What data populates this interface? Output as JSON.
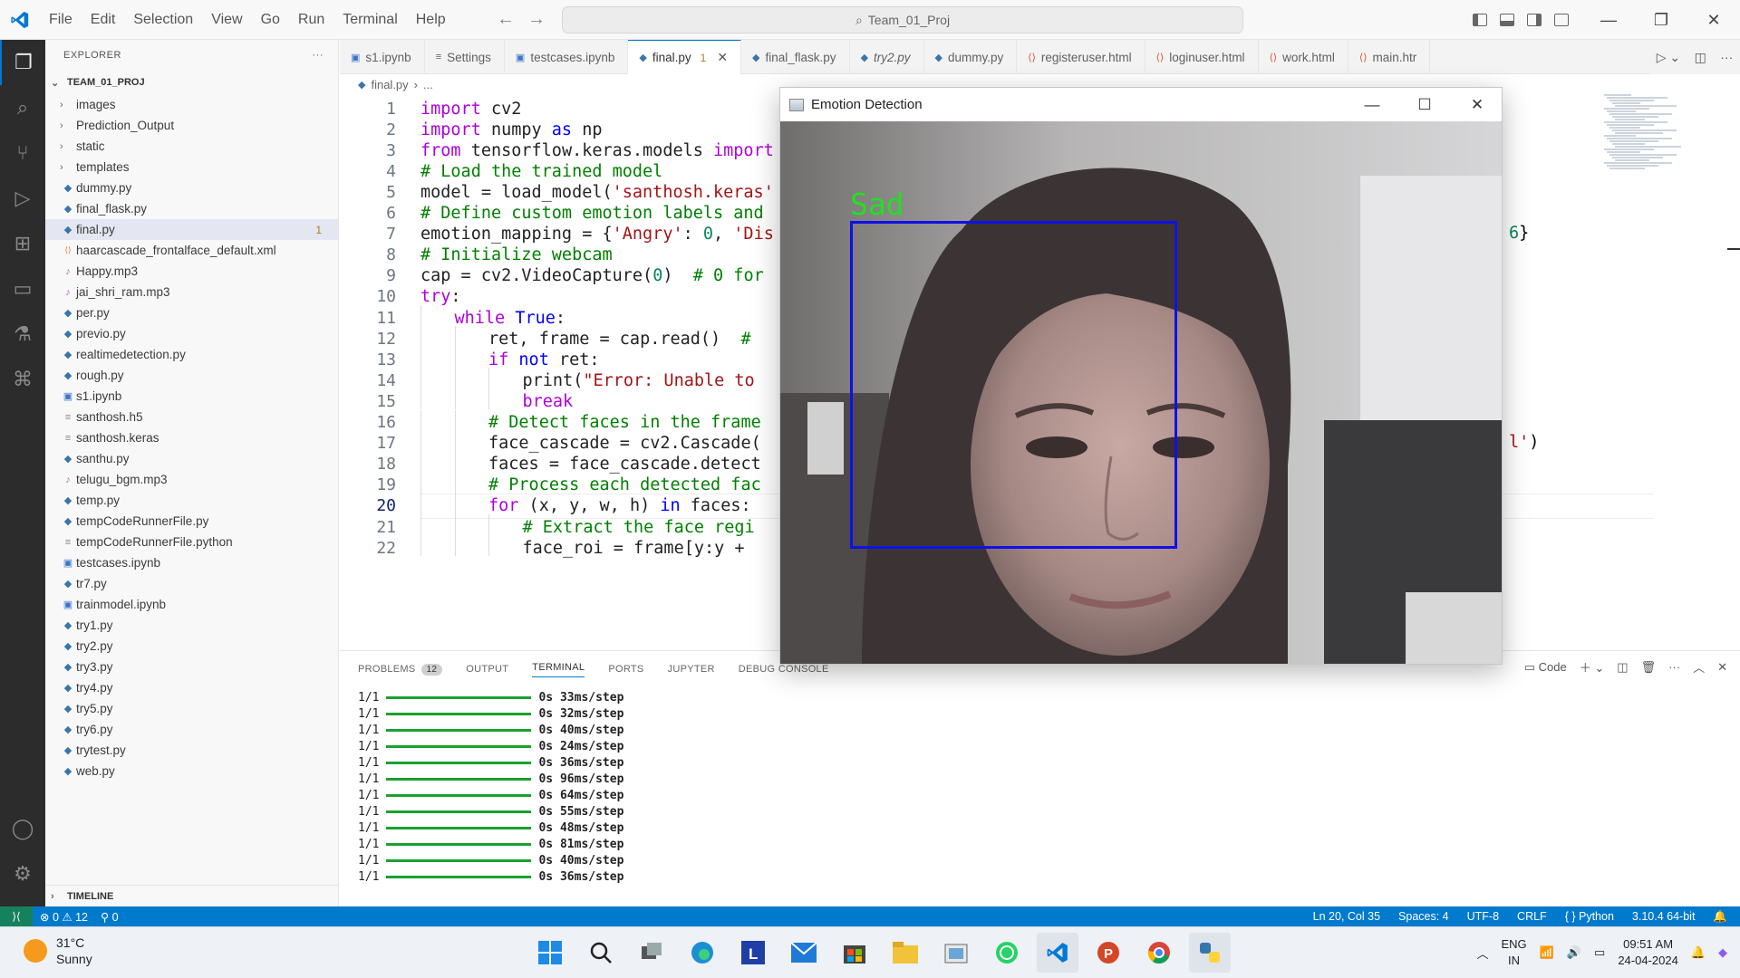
{
  "window": {
    "menu": [
      "File",
      "Edit",
      "Selection",
      "View",
      "Go",
      "Run",
      "Terminal",
      "Help"
    ],
    "search_text": "Team_01_Proj"
  },
  "explorer": {
    "title": "EXPLORER",
    "project": "TEAM_01_PROJ",
    "folders": [
      "images",
      "Prediction_Output",
      "static",
      "templates"
    ],
    "files": [
      {
        "name": "dummy.py",
        "type": "py"
      },
      {
        "name": "final_flask.py",
        "type": "py"
      },
      {
        "name": "final.py",
        "type": "py",
        "badge": "1",
        "selected": true
      },
      {
        "name": "haarcascade_frontalface_default.xml",
        "type": "xml"
      },
      {
        "name": "Happy.mp3",
        "type": "mp3"
      },
      {
        "name": "jai_shri_ram.mp3",
        "type": "mp3"
      },
      {
        "name": "per.py",
        "type": "py"
      },
      {
        "name": "previo.py",
        "type": "py"
      },
      {
        "name": "realtimedetection.py",
        "type": "py"
      },
      {
        "name": "rough.py",
        "type": "py"
      },
      {
        "name": "s1.ipynb",
        "type": "nb"
      },
      {
        "name": "santhosh.h5",
        "type": "txt"
      },
      {
        "name": "santhosh.keras",
        "type": "txt"
      },
      {
        "name": "santhu.py",
        "type": "py"
      },
      {
        "name": "telugu_bgm.mp3",
        "type": "mp3"
      },
      {
        "name": "temp.py",
        "type": "py"
      },
      {
        "name": "tempCodeRunnerFile.py",
        "type": "py"
      },
      {
        "name": "tempCodeRunnerFile.python",
        "type": "txt"
      },
      {
        "name": "testcases.ipynb",
        "type": "nb"
      },
      {
        "name": "tr7.py",
        "type": "py"
      },
      {
        "name": "trainmodel.ipynb",
        "type": "nb"
      },
      {
        "name": "try1.py",
        "type": "py"
      },
      {
        "name": "try2.py",
        "type": "py"
      },
      {
        "name": "try3.py",
        "type": "py"
      },
      {
        "name": "try4.py",
        "type": "py"
      },
      {
        "name": "try5.py",
        "type": "py"
      },
      {
        "name": "try6.py",
        "type": "py"
      },
      {
        "name": "trytest.py",
        "type": "py"
      },
      {
        "name": "web.py",
        "type": "py"
      }
    ],
    "timeline": "TIMELINE"
  },
  "tabs": [
    {
      "label": "s1.ipynb",
      "icon": "notebook-icon"
    },
    {
      "label": "Settings",
      "icon": "settings-icon"
    },
    {
      "label": "testcases.ipynb",
      "icon": "notebook-icon"
    },
    {
      "label": "final.py",
      "icon": "python-icon",
      "active": true,
      "badge": "1"
    },
    {
      "label": "final_flask.py",
      "icon": "python-icon"
    },
    {
      "label": "try2.py",
      "icon": "python-icon",
      "italic": true
    },
    {
      "label": "dummy.py",
      "icon": "python-icon"
    },
    {
      "label": "registeruser.html",
      "icon": "html-icon"
    },
    {
      "label": "loginuser.html",
      "icon": "html-icon"
    },
    {
      "label": "work.html",
      "icon": "html-icon"
    },
    {
      "label": "main.htr",
      "icon": "html-icon"
    }
  ],
  "breadcrumb": [
    "final.py",
    "..."
  ],
  "editor": {
    "current_line": 20,
    "lines": [
      {
        "n": 1,
        "indent": 0,
        "code": "import cv2"
      },
      {
        "n": 2,
        "indent": 0,
        "code": "import numpy as np"
      },
      {
        "n": 3,
        "indent": 0,
        "code": "from tensorflow.keras.models import"
      },
      {
        "n": 4,
        "indent": 0,
        "code": "# Load the trained model"
      },
      {
        "n": 5,
        "indent": 0,
        "code": "model = load_model('santhosh.keras'"
      },
      {
        "n": 6,
        "indent": 0,
        "code": "# Define custom emotion labels and"
      },
      {
        "n": 7,
        "indent": 0,
        "code": "emotion_mapping = {'Angry': 0, 'Dis"
      },
      {
        "n": 8,
        "indent": 0,
        "code": "# Initialize webcam"
      },
      {
        "n": 9,
        "indent": 0,
        "code": "cap = cv2.VideoCapture(0)  # 0 for"
      },
      {
        "n": 10,
        "indent": 0,
        "code": "try:"
      },
      {
        "n": 11,
        "indent": 1,
        "code": "while True:"
      },
      {
        "n": 12,
        "indent": 2,
        "code": "ret, frame = cap.read()  #"
      },
      {
        "n": 13,
        "indent": 2,
        "code": "if not ret:"
      },
      {
        "n": 14,
        "indent": 3,
        "code": "print(\"Error: Unable to"
      },
      {
        "n": 15,
        "indent": 3,
        "code": "break"
      },
      {
        "n": 16,
        "indent": 2,
        "code": "# Detect faces in the frame"
      },
      {
        "n": 17,
        "indent": 2,
        "code": "face_cascade = cv2.Cascade("
      },
      {
        "n": 18,
        "indent": 2,
        "code": "faces = face_cascade.detect"
      },
      {
        "n": 19,
        "indent": 2,
        "code": "# Process each detected fac"
      },
      {
        "n": 20,
        "indent": 2,
        "code": "for (x, y, w, h) in faces:"
      },
      {
        "n": 21,
        "indent": 3,
        "code": "# Extract the face regi"
      },
      {
        "n": 22,
        "indent": 3,
        "code": "face_roi = frame[y:y +"
      }
    ],
    "line7_tail": "6}",
    "line17_tail": "l')"
  },
  "panel": {
    "tabs": [
      "PROBLEMS",
      "OUTPUT",
      "TERMINAL",
      "PORTS",
      "JUPYTER",
      "DEBUG CONSOLE"
    ],
    "active_tab": "TERMINAL",
    "problems_count": "12",
    "code_label": "Code",
    "terminal": [
      {
        "step": "1/1",
        "time": "0s 33ms/step"
      },
      {
        "step": "1/1",
        "time": "0s 32ms/step"
      },
      {
        "step": "1/1",
        "time": "0s 40ms/step"
      },
      {
        "step": "1/1",
        "time": "0s 24ms/step"
      },
      {
        "step": "1/1",
        "time": "0s 36ms/step"
      },
      {
        "step": "1/1",
        "time": "0s 96ms/step"
      },
      {
        "step": "1/1",
        "time": "0s 64ms/step"
      },
      {
        "step": "1/1",
        "time": "0s 55ms/step"
      },
      {
        "step": "1/1",
        "time": "0s 48ms/step"
      },
      {
        "step": "1/1",
        "time": "0s 81ms/step"
      },
      {
        "step": "1/1",
        "time": "0s 40ms/step"
      },
      {
        "step": "1/1",
        "time": "0s 36ms/step"
      }
    ]
  },
  "status": {
    "errors": "0",
    "warnings": "12",
    "ports": "0",
    "position": "Ln 20, Col 35",
    "spaces": "Spaces: 4",
    "encoding": "UTF-8",
    "eol": "CRLF",
    "language": "Python",
    "interpreter": "3.10.4 64-bit"
  },
  "emotion_window": {
    "title": "Emotion Detection",
    "label": "Sad",
    "label_color": "#22e022",
    "box_color": "#1010e8"
  },
  "taskbar": {
    "temperature": "31°C",
    "weather": "Sunny",
    "lang_top": "ENG",
    "lang_bottom": "IN",
    "time": "09:51 AM",
    "date": "24-04-2024"
  },
  "colors": {
    "accent": "#0078d4",
    "statusbar": "#007acc",
    "activitybar": "#2c2c2c"
  }
}
